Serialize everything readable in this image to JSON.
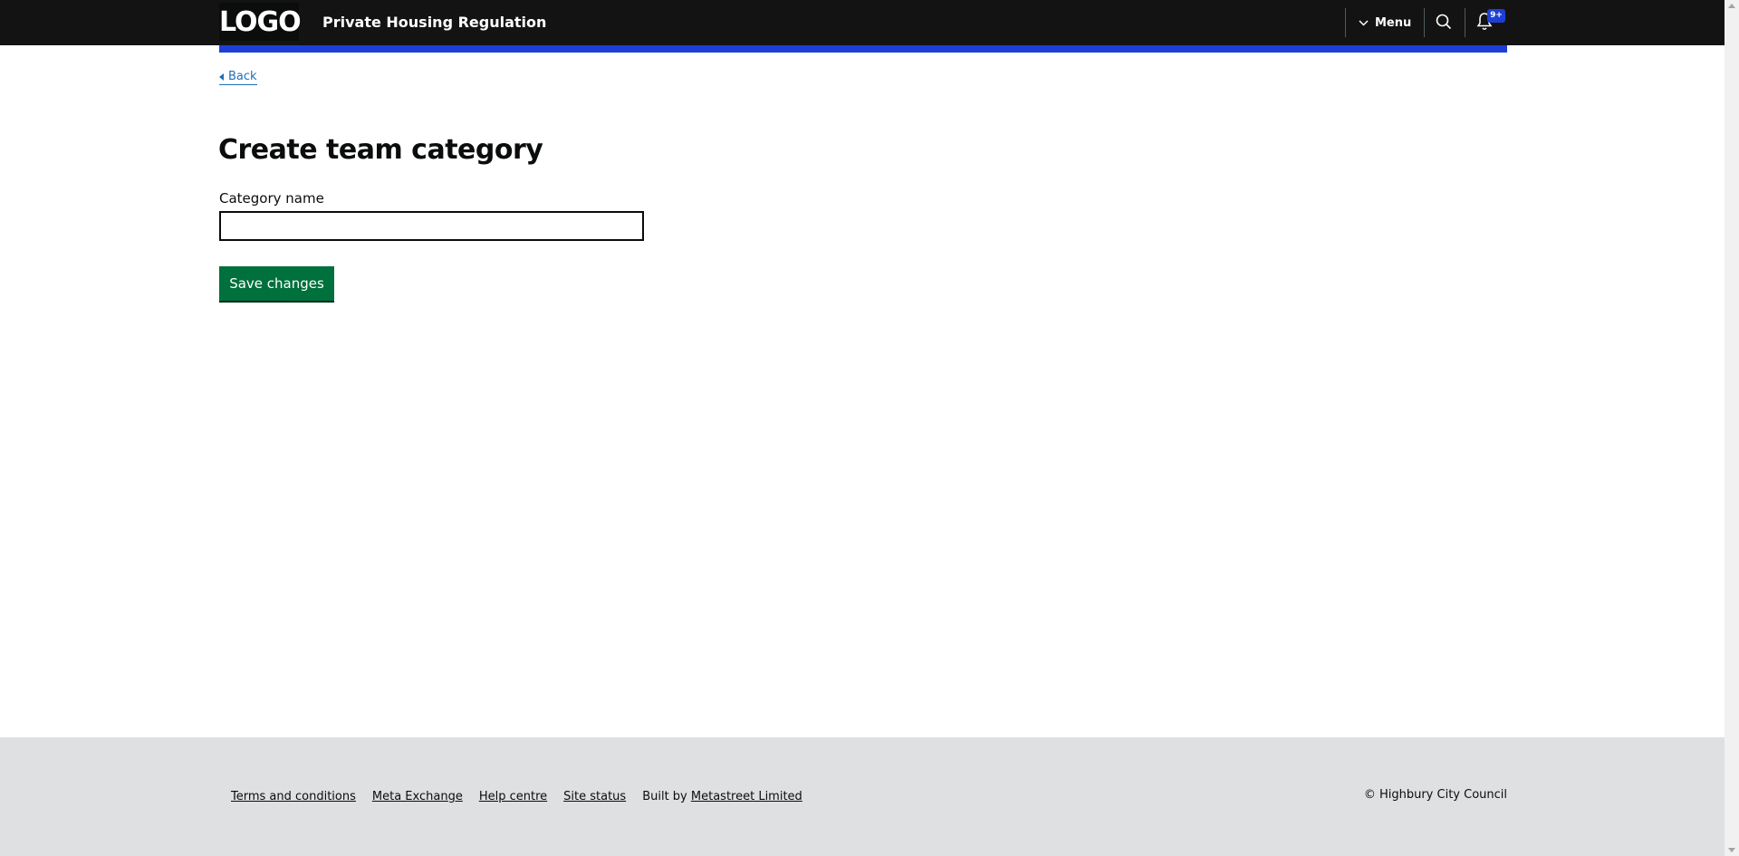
{
  "header": {
    "logo_text": "LOGO",
    "service_name": "Private Housing Regulation",
    "menu_label": "Menu",
    "notifications_badge": "9+",
    "icons": {
      "menu": "chevron-down-icon",
      "search": "search-icon",
      "notifications": "bell-icon"
    },
    "colors": {
      "background": "#141314",
      "accent_bar": "#1d3fd6"
    }
  },
  "nav": {
    "back_label": "Back"
  },
  "main": {
    "title": "Create team category",
    "field_label": "Category name",
    "field_value": "",
    "save_label": "Save changes",
    "colors": {
      "save_button": "#00703c"
    }
  },
  "footer": {
    "links": [
      "Terms and conditions",
      "Meta Exchange",
      "Help centre",
      "Site status"
    ],
    "built_by_prefix": "Built by",
    "built_by_link": "Metastreet Limited",
    "copyright": "© Highbury City Council",
    "colors": {
      "background": "#dfe0e1"
    }
  }
}
